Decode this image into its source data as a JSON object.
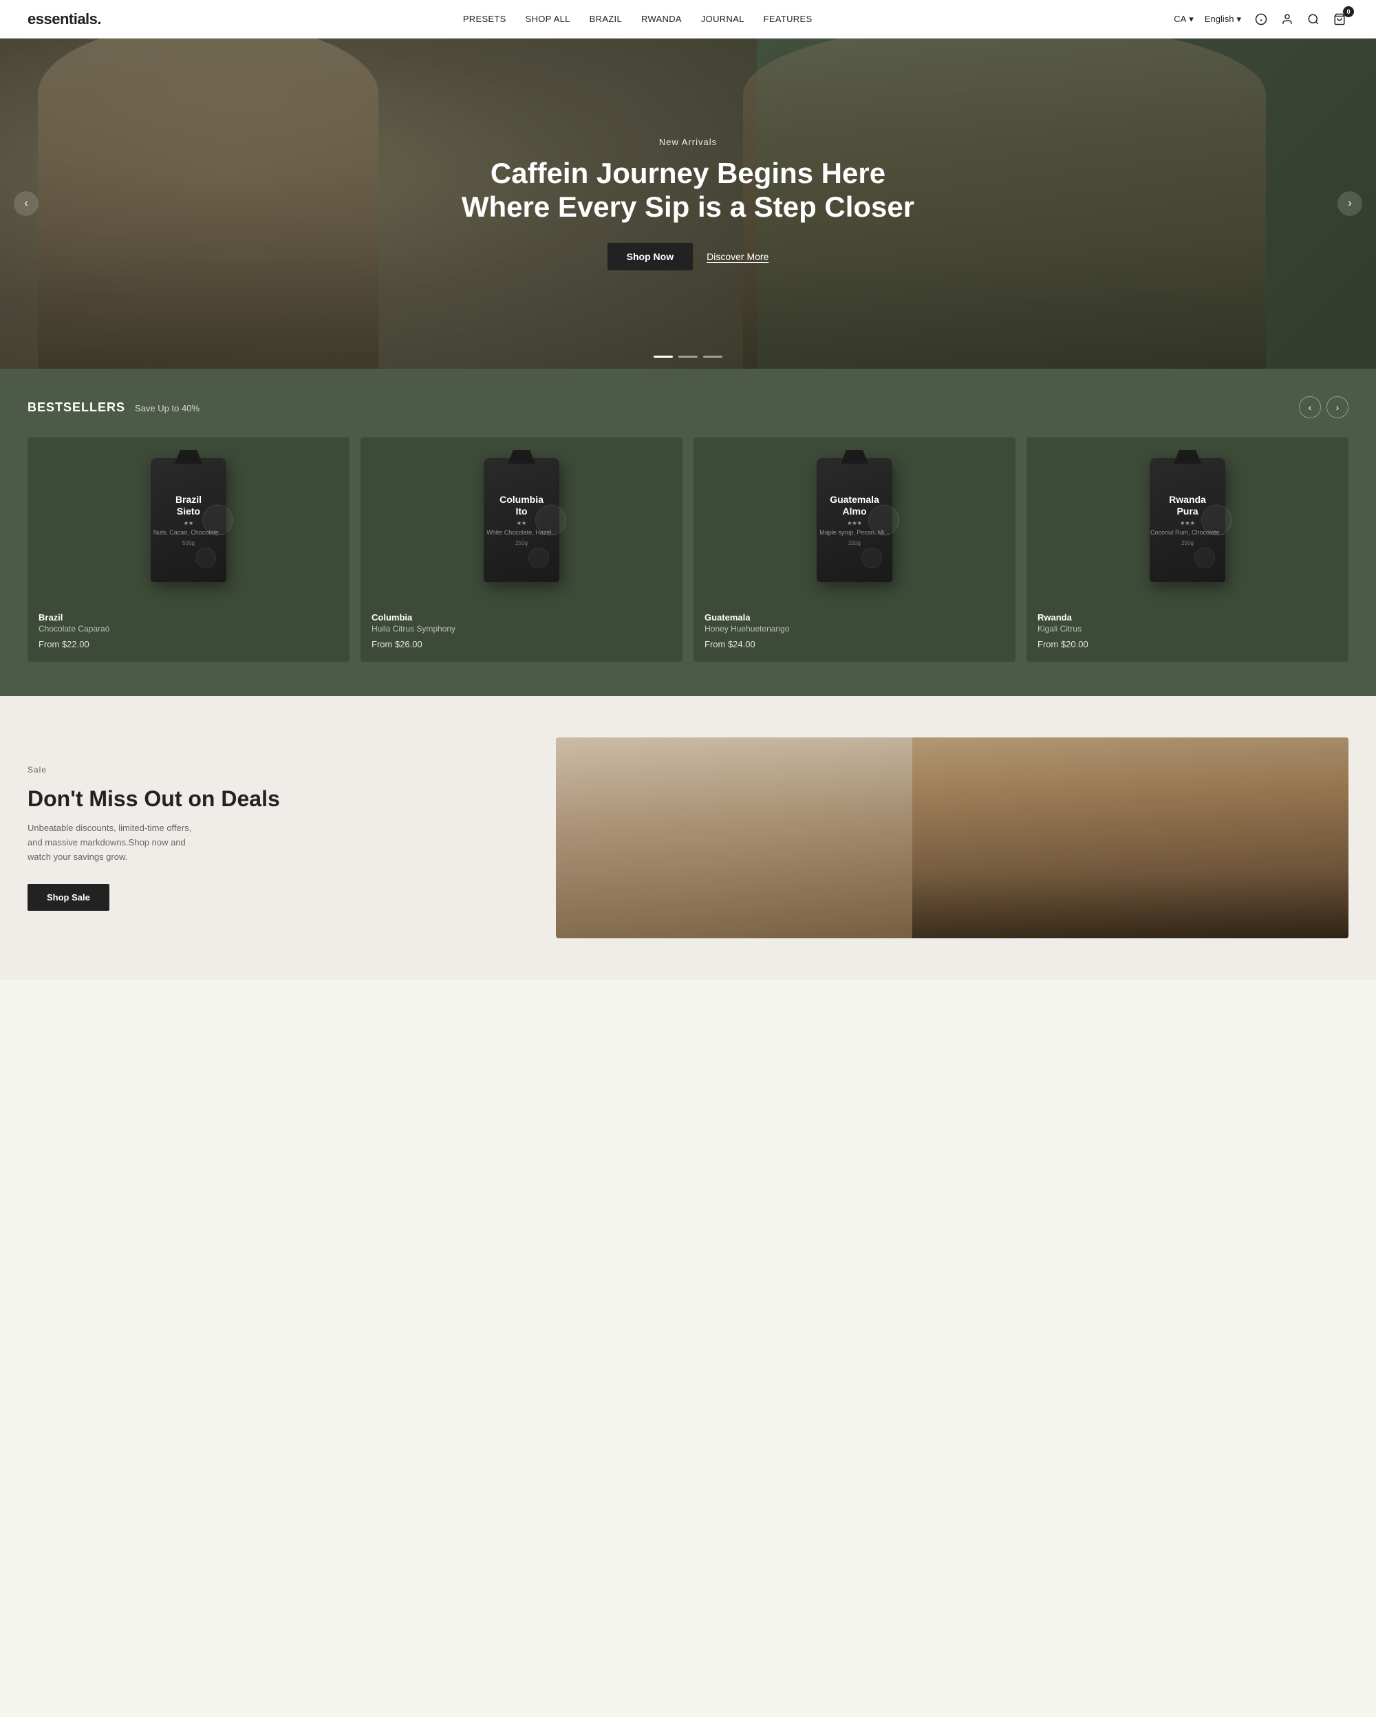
{
  "brand": {
    "logo": "essentials."
  },
  "nav": {
    "links": [
      {
        "label": "PRESETS",
        "id": "nav-presets"
      },
      {
        "label": "SHOP ALL",
        "id": "nav-shop-all"
      },
      {
        "label": "BRAZIL",
        "id": "nav-brazil"
      },
      {
        "label": "RWANDA",
        "id": "nav-rwanda"
      },
      {
        "label": "JOURNAL",
        "id": "nav-journal"
      },
      {
        "label": "FEATURES",
        "id": "nav-features"
      }
    ],
    "locale": {
      "country": "CA",
      "language": "English"
    },
    "cart_count": "0"
  },
  "hero": {
    "tag": "New Arrivals",
    "title": "Caffein Journey Begins Here Where Every Sip is a Step Closer",
    "cta_primary": "Shop Now",
    "cta_secondary": "Discover More"
  },
  "bestsellers": {
    "title": "BESTSELLERS",
    "subtitle": "Save Up to 40%",
    "products": [
      {
        "region": "Brazil",
        "name": "Chocolate Caparaó",
        "bag_name_line1": "Brazil",
        "bag_name_line2": "Sieto",
        "notes": "Nuts, Cacao, Chocolate, Caramel",
        "weight": "500g",
        "stars": "★★",
        "price": "From $22.00"
      },
      {
        "region": "Columbia",
        "name": "Huila Citrus Symphony",
        "bag_name_line1": "Columbia",
        "bag_name_line2": "Ito",
        "notes": "White Chocolate, Hazelnut, Cinnamon",
        "weight": "250g",
        "stars": "★★",
        "price": "From $26.00"
      },
      {
        "region": "Guatemala",
        "name": "Honey Huehuetenango",
        "bag_name_line1": "Guatemala",
        "bag_name_line2": "Almo",
        "notes": "Maple syrup, Pecan, Mint",
        "weight": "250g",
        "stars": "★★★",
        "price": "From $24.00"
      },
      {
        "region": "Rwanda",
        "name": "Kigali Citrus",
        "bag_name_line1": "Rwanda",
        "bag_name_line2": "Pura",
        "notes": "Coconut Rum, Chocolate, Caramel",
        "weight": "250g",
        "stars": "★★★",
        "price": "From $20.00"
      }
    ]
  },
  "sale": {
    "tag": "Sale",
    "title": "Don't Miss Out on Deals",
    "description": "Unbeatable discounts, limited-time offers, and massive markdowns.Shop now and watch your savings grow.",
    "cta": "Shop Sale"
  }
}
